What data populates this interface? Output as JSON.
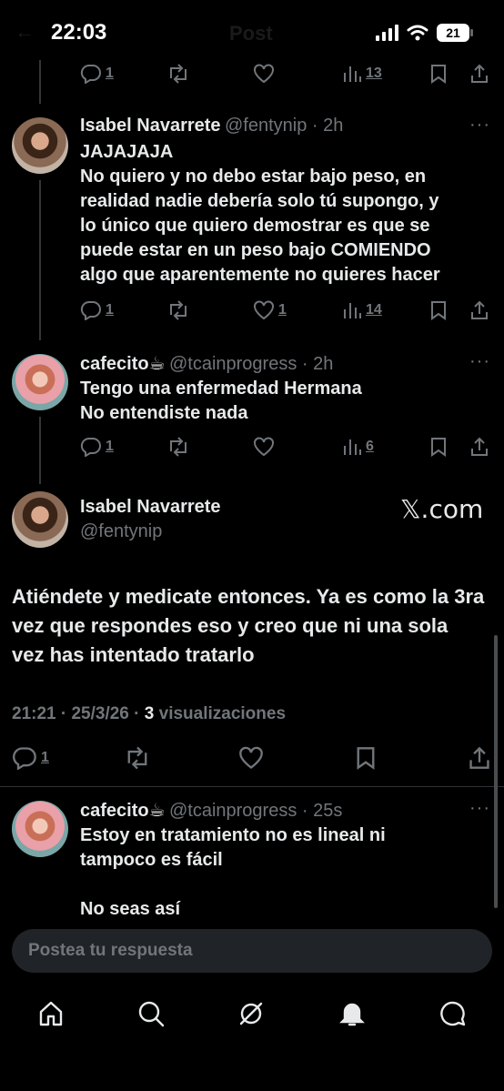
{
  "status_bar": {
    "time": "22:03",
    "battery": "21"
  },
  "header": {
    "title": "Post"
  },
  "tweet0": {
    "reply_count": "1",
    "views": "13"
  },
  "tweet1": {
    "name": "Isabel Navarrete",
    "handle_time": "@fentynip · 2h",
    "text": "JAJAJAJA\nNo quiero y no debo estar bajo peso, en\nrealidad nadie debería solo tú supongo, y\nlo único que quiero demostrar es que se\npuede estar en un peso bajo COMIENDO\nalgo que aparentemente no quieres hacer",
    "reply_count": "1",
    "like_count": "1",
    "views": "14"
  },
  "tweet2": {
    "name": "cafecito☕",
    "handle_time": "@tcainprogress · 2h",
    "text": "Tengo una enfermedad Hermana\nNo entendiste nada",
    "reply_count": "1",
    "views": "6"
  },
  "main_tweet": {
    "name": "Isabel Navarrete",
    "handle": "@fentynip",
    "source": "𝕏.com",
    "text": "Atiéndete y medicate entonces. Ya es como la 3ra vez que respondes eso y creo que ni una sola vez has intentado tratarlo",
    "timestamp": "21:21 · 25/3/26 · ",
    "view_count": "3",
    "view_label": " visualizaciones",
    "reply_count": "1"
  },
  "reply1": {
    "name": "cafecito☕",
    "handle_time": "@tcainprogress · 25s",
    "text": "Estoy en tratamiento no es lineal ni\ntampoco es fácil\n\nNo seas así"
  },
  "composer": {
    "placeholder": "Postea tu respuesta"
  },
  "more_label": "···",
  "icons": [
    "reply-icon",
    "repost-icon",
    "like-icon",
    "views-icon",
    "bookmark-icon",
    "share-icon",
    "home-icon",
    "search-icon",
    "grok-icon",
    "notifications-icon",
    "messages-icon"
  ]
}
